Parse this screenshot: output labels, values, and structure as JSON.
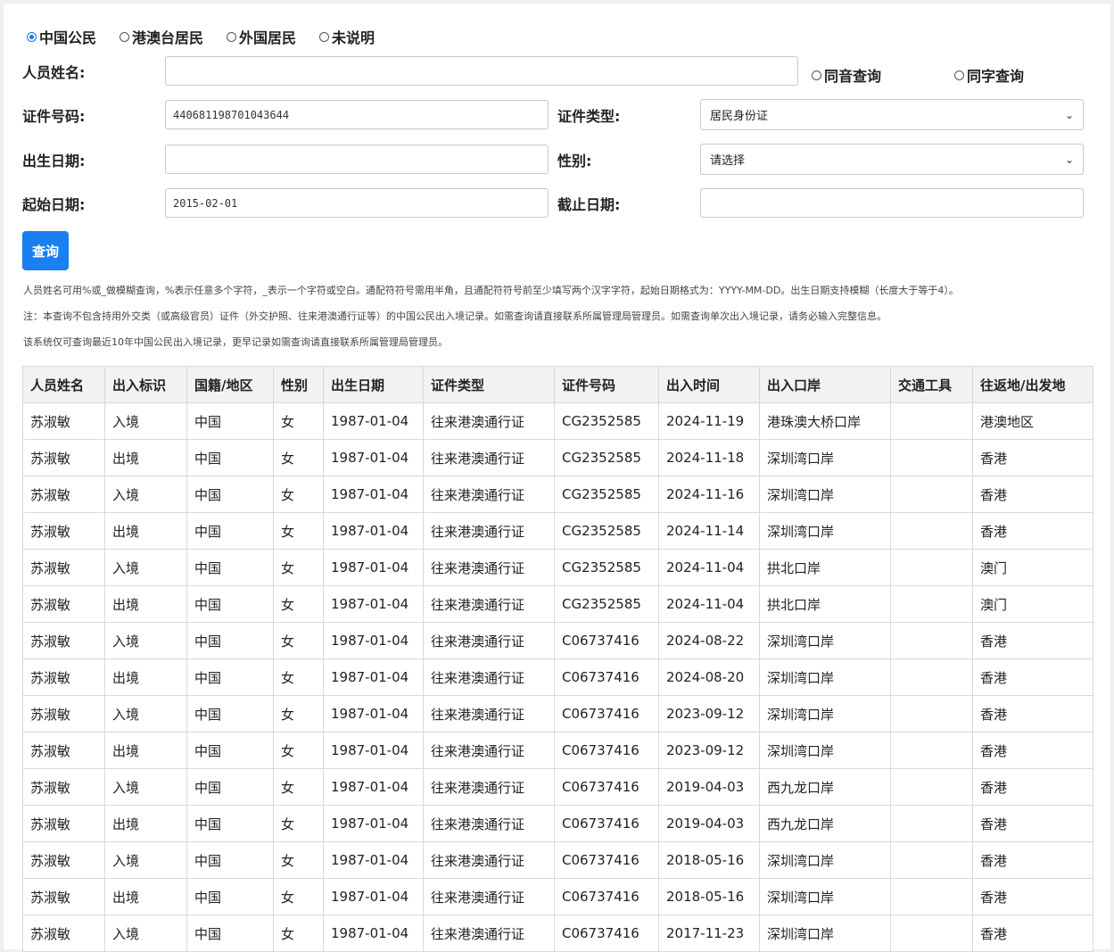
{
  "citizen_types": [
    {
      "label": "中国公民",
      "checked": true
    },
    {
      "label": "港澳台居民",
      "checked": false
    },
    {
      "label": "外国居民",
      "checked": false
    },
    {
      "label": "未说明",
      "checked": false
    }
  ],
  "form": {
    "name_label": "人员姓名:",
    "name_value": "",
    "homophone_label": "同音查询",
    "same_char_label": "同字查询",
    "id_label": "证件号码:",
    "id_value": "440681198701043644",
    "doc_type_label": "证件类型:",
    "doc_type_value": "居民身份证",
    "dob_label": "出生日期:",
    "dob_value": "",
    "gender_label": "性别:",
    "gender_value": "请选择",
    "start_label": "起始日期:",
    "start_value": "2015-02-01",
    "end_label": "截止日期:",
    "end_value": "",
    "submit_label": "查询"
  },
  "notes": [
    "人员姓名可用%或_做模糊查询，%表示任意多个字符，_表示一个字符或空白。通配符符号需用半角，且通配符符号前至少填写两个汉字字符，起始日期格式为：YYYY-MM-DD。出生日期支持模糊（长度大于等于4）。",
    "注：本查询不包含持用外交类（或高级官员）证件（外交护照、往来港澳通行证等）的中国公民出入境记录。如需查询请直接联系所属管理局管理员。如需查询单次出入境记录，请务必输入完整信息。",
    "该系统仅可查询最近10年中国公民出入境记录，更早记录如需查询请直接联系所属管理局管理员。"
  ],
  "table": {
    "headers": [
      "人员姓名",
      "出入标识",
      "国籍/地区",
      "性别",
      "出生日期",
      "证件类型",
      "证件号码",
      "出入时间",
      "出入口岸",
      "交通工具",
      "往返地/出发地"
    ],
    "rows": [
      [
        "苏淑敏",
        "入境",
        "中国",
        "女",
        "1987-01-04",
        "往来港澳通行证",
        "CG2352585",
        "2024-11-19",
        "港珠澳大桥口岸",
        "",
        "港澳地区"
      ],
      [
        "苏淑敏",
        "出境",
        "中国",
        "女",
        "1987-01-04",
        "往来港澳通行证",
        "CG2352585",
        "2024-11-18",
        "深圳湾口岸",
        "",
        "香港"
      ],
      [
        "苏淑敏",
        "入境",
        "中国",
        "女",
        "1987-01-04",
        "往来港澳通行证",
        "CG2352585",
        "2024-11-16",
        "深圳湾口岸",
        "",
        "香港"
      ],
      [
        "苏淑敏",
        "出境",
        "中国",
        "女",
        "1987-01-04",
        "往来港澳通行证",
        "CG2352585",
        "2024-11-14",
        "深圳湾口岸",
        "",
        "香港"
      ],
      [
        "苏淑敏",
        "入境",
        "中国",
        "女",
        "1987-01-04",
        "往来港澳通行证",
        "CG2352585",
        "2024-11-04",
        "拱北口岸",
        "",
        "澳门"
      ],
      [
        "苏淑敏",
        "出境",
        "中国",
        "女",
        "1987-01-04",
        "往来港澳通行证",
        "CG2352585",
        "2024-11-04",
        "拱北口岸",
        "",
        "澳门"
      ],
      [
        "苏淑敏",
        "入境",
        "中国",
        "女",
        "1987-01-04",
        "往来港澳通行证",
        "C06737416",
        "2024-08-22",
        "深圳湾口岸",
        "",
        "香港"
      ],
      [
        "苏淑敏",
        "出境",
        "中国",
        "女",
        "1987-01-04",
        "往来港澳通行证",
        "C06737416",
        "2024-08-20",
        "深圳湾口岸",
        "",
        "香港"
      ],
      [
        "苏淑敏",
        "入境",
        "中国",
        "女",
        "1987-01-04",
        "往来港澳通行证",
        "C06737416",
        "2023-09-12",
        "深圳湾口岸",
        "",
        "香港"
      ],
      [
        "苏淑敏",
        "出境",
        "中国",
        "女",
        "1987-01-04",
        "往来港澳通行证",
        "C06737416",
        "2023-09-12",
        "深圳湾口岸",
        "",
        "香港"
      ],
      [
        "苏淑敏",
        "入境",
        "中国",
        "女",
        "1987-01-04",
        "往来港澳通行证",
        "C06737416",
        "2019-04-03",
        "西九龙口岸",
        "",
        "香港"
      ],
      [
        "苏淑敏",
        "出境",
        "中国",
        "女",
        "1987-01-04",
        "往来港澳通行证",
        "C06737416",
        "2019-04-03",
        "西九龙口岸",
        "",
        "香港"
      ],
      [
        "苏淑敏",
        "入境",
        "中国",
        "女",
        "1987-01-04",
        "往来港澳通行证",
        "C06737416",
        "2018-05-16",
        "深圳湾口岸",
        "",
        "香港"
      ],
      [
        "苏淑敏",
        "出境",
        "中国",
        "女",
        "1987-01-04",
        "往来港澳通行证",
        "C06737416",
        "2018-05-16",
        "深圳湾口岸",
        "",
        "香港"
      ],
      [
        "苏淑敏",
        "入境",
        "中国",
        "女",
        "1987-01-04",
        "往来港澳通行证",
        "C06737416",
        "2017-11-23",
        "深圳湾口岸",
        "",
        "香港"
      ]
    ]
  }
}
